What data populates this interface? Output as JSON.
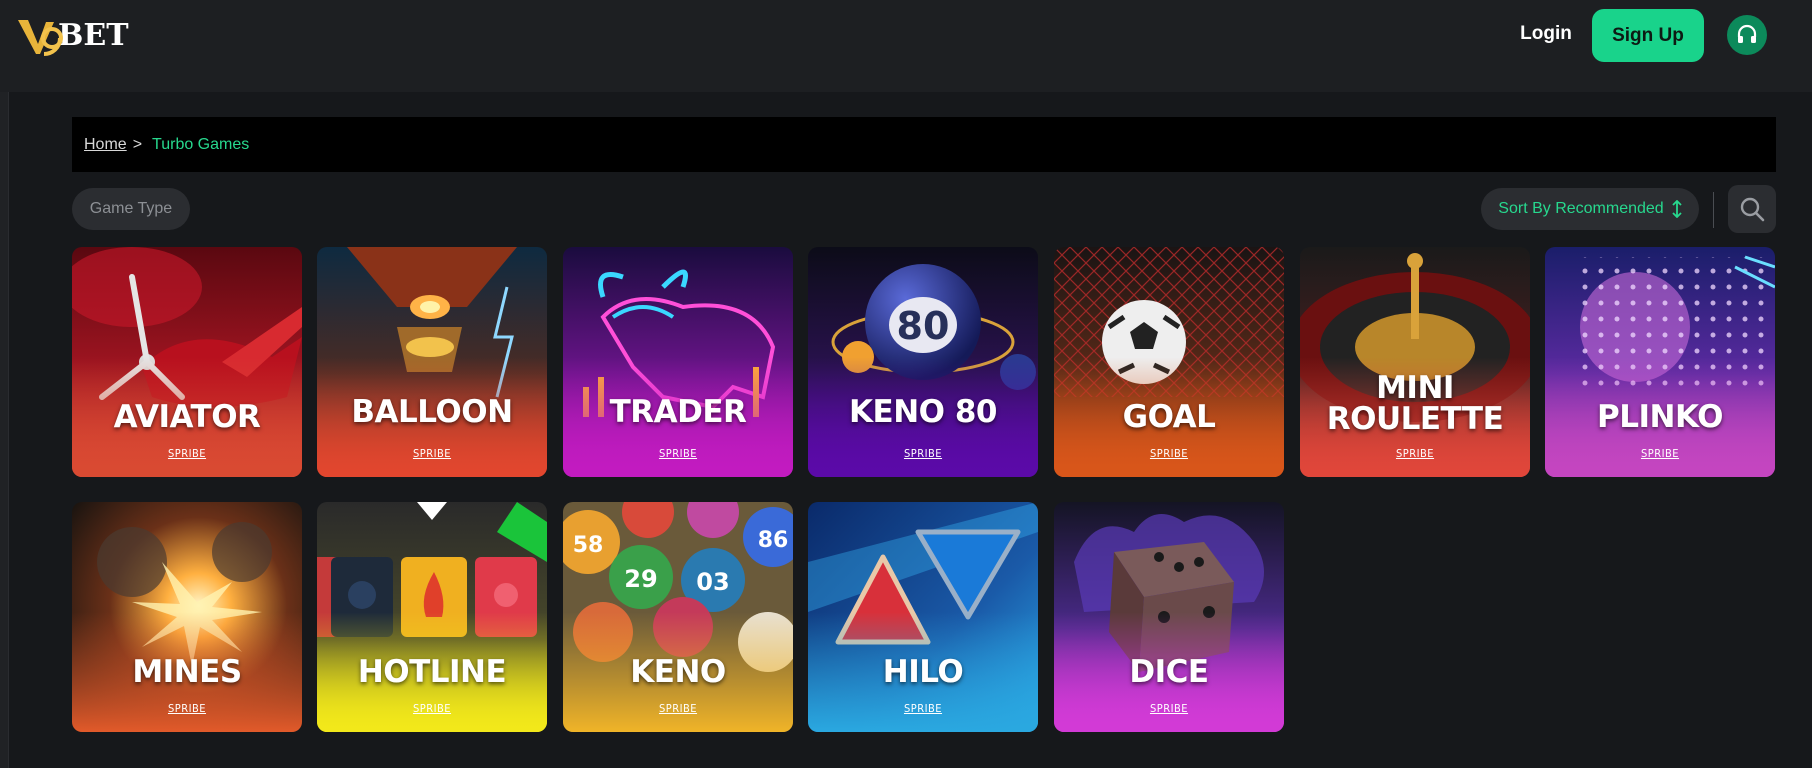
{
  "header": {
    "logo_text": "BET",
    "logo_mark": "V9",
    "login_label": "Login",
    "signup_label": "Sign Up",
    "support_icon": "headset-icon",
    "accent_color": "#19d38b"
  },
  "breadcrumb": {
    "home": "Home",
    "separator": ">",
    "current": "Turbo Games"
  },
  "filters": {
    "game_type_label": "Game Type",
    "sort_label": "Sort By Recommended",
    "sort_icon": "sort-arrows-icon",
    "search_icon": "search-icon"
  },
  "games": [
    {
      "name": "AVIATOR",
      "provider": "SPRIBE"
    },
    {
      "name": "BALLOON",
      "provider": "SPRIBE"
    },
    {
      "name": "TRADER",
      "provider": "SPRIBE"
    },
    {
      "name": "KENO 80",
      "provider": "SPRIBE"
    },
    {
      "name": "GOAL",
      "provider": "SPRIBE"
    },
    {
      "name": "MINI ROULETTE",
      "provider": "SPRIBE"
    },
    {
      "name": "PLINKO",
      "provider": "SPRIBE"
    },
    {
      "name": "MINES",
      "provider": "SPRIBE"
    },
    {
      "name": "HOTLINE",
      "provider": "SPRIBE"
    },
    {
      "name": "KENO",
      "provider": "SPRIBE"
    },
    {
      "name": "HILO",
      "provider": "SPRIBE"
    },
    {
      "name": "DICE",
      "provider": "SPRIBE"
    }
  ]
}
